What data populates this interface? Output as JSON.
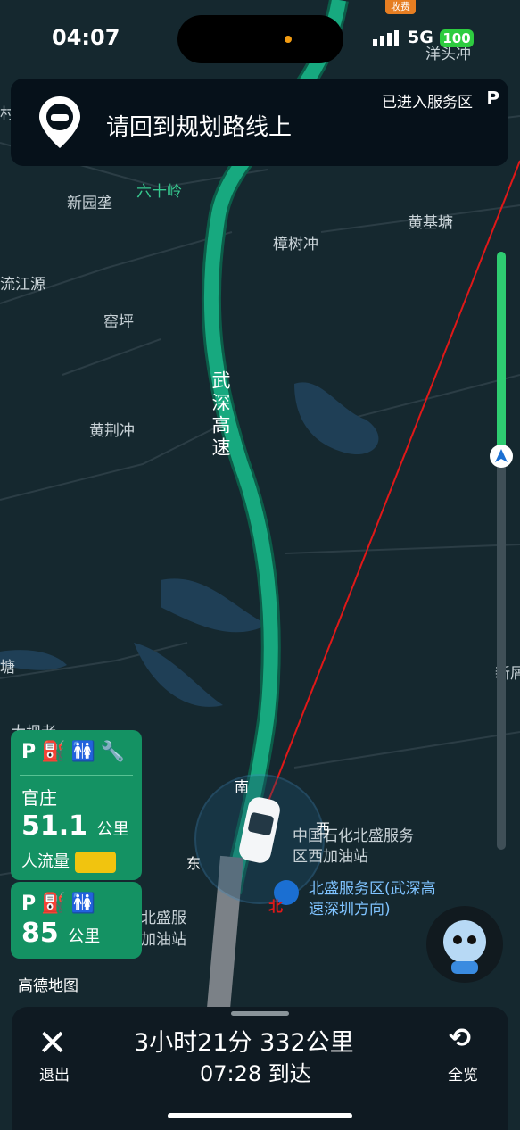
{
  "status": {
    "time": "04:07",
    "network": "5G",
    "battery": "100",
    "toll_badge": "收费"
  },
  "banner": {
    "title": "请回到规划路线上",
    "sub": "已进入服务区",
    "p_symbol": "P"
  },
  "map": {
    "labels": [
      "六十岭",
      "新园垄",
      "樟树冲",
      "黄基塘",
      "流江源",
      "窑坪",
      "黄荆冲",
      "武深高速",
      "中国石化北盛服务区西加油站",
      "北盛服务区(武深高速深圳方向)",
      "洋头冲"
    ],
    "compass": {
      "north": "南",
      "west": "西",
      "east": "东",
      "north_badge": "北"
    },
    "edge_labels": [
      "村",
      "塘",
      "新屑",
      "大坝老",
      "北盛服",
      "加油站"
    ]
  },
  "service_areas": [
    {
      "icons": "P⛽🚻🔧",
      "name": "官庄",
      "distance": "51.1",
      "unit": "公里",
      "traffic_label": "人流量"
    },
    {
      "icons": "P⛽🚻",
      "distance": "85",
      "unit": "公里"
    }
  ],
  "brand": {
    "logo_text": "高德地图"
  },
  "bottom": {
    "exit_label": "退出",
    "eta_summary": "3小时21分  332公里",
    "arrival": "07:28 到达",
    "overview_label": "全览"
  },
  "colors": {
    "route": "#13a47a",
    "accent": "#149263",
    "background": "#14262e"
  }
}
